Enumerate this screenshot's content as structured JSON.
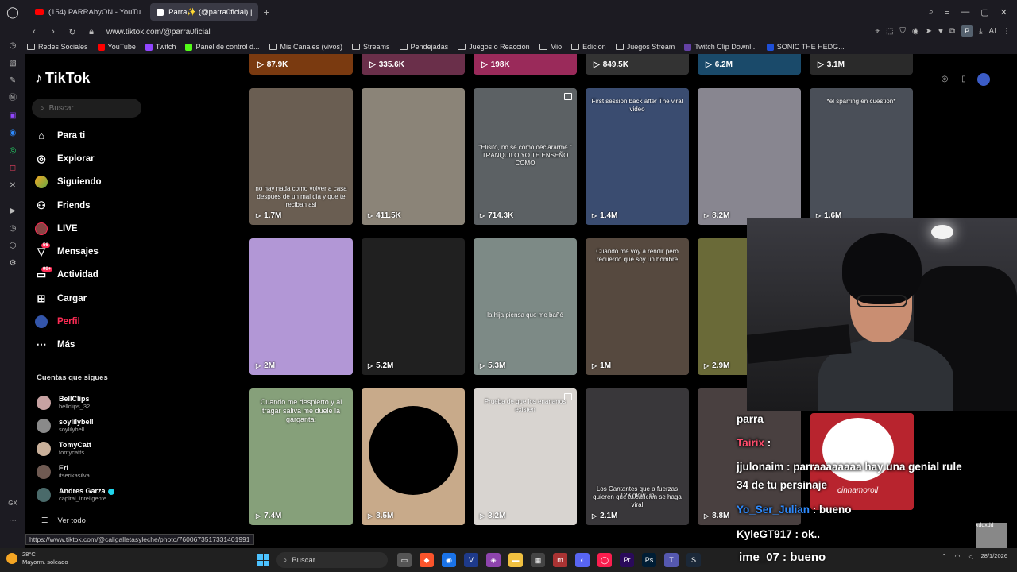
{
  "browser": {
    "tabs": [
      {
        "label": "(154) PARRAbyON - YouTu",
        "active": false,
        "type": "youtube"
      },
      {
        "label": "Parra✨ (@parra0ficial) |",
        "active": true,
        "type": "tiktok"
      }
    ],
    "url": "www.tiktok.com/@parra0ficial",
    "ext_p": "P",
    "ext_ai": "AI",
    "bookmarks": [
      {
        "label": "Redes Sociales",
        "kind": "folder"
      },
      {
        "label": "YouTube",
        "kind": "youtube"
      },
      {
        "label": "Twitch",
        "kind": "twitch"
      },
      {
        "label": "Panel de control d...",
        "kind": "kick"
      },
      {
        "label": "Mis Canales (vivos)",
        "kind": "folder"
      },
      {
        "label": "Streams",
        "kind": "folder"
      },
      {
        "label": "Pendejadas",
        "kind": "folder"
      },
      {
        "label": "Juegos o Reaccion",
        "kind": "folder"
      },
      {
        "label": "Mio",
        "kind": "folder"
      },
      {
        "label": "Edicion",
        "kind": "folder"
      },
      {
        "label": "Juegos Stream",
        "kind": "folder"
      },
      {
        "label": "Twitch Clip Downl...",
        "kind": "clip"
      },
      {
        "label": "SONIC THE HEDG...",
        "kind": "sonic"
      }
    ],
    "status_url": "https://www.tiktok.com/@caligalletasyleche/photo/7600673517331401991"
  },
  "tiktok": {
    "brand": "TikTok",
    "search_placeholder": "Buscar",
    "nav": [
      {
        "label": "Para ti",
        "icon": "home-icon",
        "active": false
      },
      {
        "label": "Explorar",
        "icon": "compass-icon",
        "active": false
      },
      {
        "label": "Siguiendo",
        "icon": "avatar",
        "active": false
      },
      {
        "label": "Friends",
        "icon": "friends-icon",
        "active": false
      },
      {
        "label": "LIVE",
        "icon": "live-avatar",
        "active": false
      },
      {
        "label": "Mensajes",
        "icon": "messages-icon",
        "active": false,
        "badge": "56"
      },
      {
        "label": "Actividad",
        "icon": "activity-icon",
        "active": false,
        "badge": "99+"
      },
      {
        "label": "Cargar",
        "icon": "upload-icon",
        "active": false
      },
      {
        "label": "Perfil",
        "icon": "profile-avatar",
        "active": true
      },
      {
        "label": "Más",
        "icon": "more-icon",
        "active": false
      }
    ],
    "follows_title": "Cuentas que sigues",
    "follows": [
      {
        "name": "BellClips",
        "user": "bellclips_32"
      },
      {
        "name": "soylilybell",
        "user": "soylilybell"
      },
      {
        "name": "TomyCatt",
        "user": "tomycatts"
      },
      {
        "name": "Eri",
        "user": "itserikasilva"
      },
      {
        "name": "Andres Garza",
        "user": "capital_inteligente",
        "verified": true
      }
    ],
    "see_all": "Ver todo",
    "top_row_views": [
      "87.9K",
      "335.6K",
      "198K",
      "849.5K",
      "6.2M",
      "3.1M"
    ],
    "rows": [
      [
        {
          "views": "1.7M",
          "caption": "no hay nada como volver a casa despues de un mal dia y que te reciban asi",
          "bg": "#6a5e52"
        },
        {
          "views": "411.5K",
          "caption": "",
          "bg": "#8b8478"
        },
        {
          "views": "714.3K",
          "caption": "\"Elisito, no se como declararme.\" TRANQUILO YO TE ENSEÑO COMO",
          "bg": "#5c6164",
          "pinned": true
        },
        {
          "views": "1.4M",
          "caption": "First session back after The viral video",
          "bg": "#3a4c70"
        },
        {
          "views": "8.2M",
          "caption": "",
          "bg": "#888690"
        },
        {
          "views": "1.6M",
          "caption": "*el sparring en cuestion*",
          "bg": "#4a4f58"
        }
      ],
      [
        {
          "views": "2M",
          "caption": "",
          "bg": "#b297d6"
        },
        {
          "views": "5.2M",
          "caption": "",
          "bg": "#202020"
        },
        {
          "views": "5.3M",
          "caption": "la hija piensa que me bañé",
          "bg": "#7d8a86"
        },
        {
          "views": "1M",
          "caption": "Cuando me voy a rendir pero recuerdo que soy un hombre",
          "bg": "#56493f"
        },
        {
          "views": "2.9M",
          "caption": "",
          "bg": "#6a6a38"
        }
      ],
      [
        {
          "views": "7.4M",
          "caption": "Cuando me despierto y al tragar saliva me duele la garganta:",
          "bg": "#86a07a"
        },
        {
          "views": "8.5M",
          "caption": "",
          "bg": "#c8aa8a",
          "circle": true
        },
        {
          "views": "3.2M",
          "caption": "Prueba de que los enananos existen",
          "bg": "#d8d4d0",
          "pinned": true
        },
        {
          "views": "2.1M",
          "caption": "Los Cantantes que a fuerzas quieren que tu cancion se haga viral",
          "bg": "#39373a",
          "bottom_caption": "123 glow up"
        },
        {
          "views": "8.8M",
          "caption": "",
          "bg": "#494040"
        }
      ]
    ]
  },
  "chat": {
    "lines": [
      {
        "text": "parra"
      },
      {
        "user": "Tairix",
        "text": " :"
      },
      {
        "user": "jjulonaim",
        "text": " : parraaaaaaaa hay una genial rule"
      },
      {
        "text": "34 de tu persinaje"
      },
      {
        "user": "Yo_Ser_Julian",
        "text": " : bueno"
      },
      {
        "user": "KyleGT917",
        "text": " : ok.."
      }
    ],
    "big_line": "ime_07 : bueno",
    "sticker_text": "cinnamoroll",
    "corner_tag": "xddxdd"
  },
  "taskbar": {
    "temp": "28°C",
    "weather": "Mayorm. soleado",
    "search": "Buscar",
    "date": "28/1/2026"
  }
}
